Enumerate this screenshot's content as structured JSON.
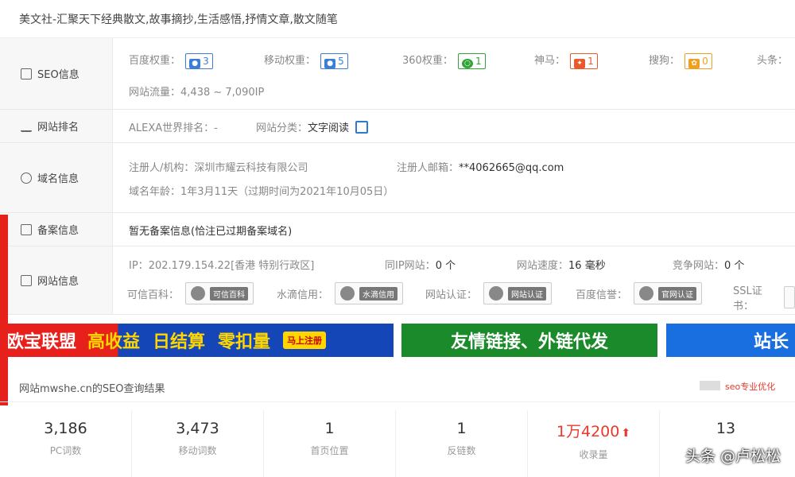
{
  "page_title": "美文社-汇聚天下经典散文,故事摘抄,生活感悟,抒情文章,散文随笔",
  "seo_row": {
    "label": "SEO信息",
    "items": [
      {
        "label": "百度权重：",
        "value": "3",
        "color": "#3a7fd5"
      },
      {
        "label": "移动权重：",
        "value": "5",
        "color": "#3a7fd5"
      },
      {
        "label": "360权重：",
        "value": "1",
        "color": "#2fa535"
      },
      {
        "label": "神马：",
        "value": "1",
        "color": "#e85a2c"
      },
      {
        "label": "搜狗：",
        "value": "0",
        "color": "#f0a020"
      },
      {
        "label": "头条：",
        "value": ""
      }
    ],
    "traffic_label": "网站流量：",
    "traffic_value": "4,438 ~ 7,090IP"
  },
  "rank_row": {
    "label": "网站排名",
    "alexa_label": "ALEXA世界排名：",
    "alexa_value": "-",
    "category_label": "网站分类：",
    "category_value": "文字阅读"
  },
  "domain_row": {
    "label": "域名信息",
    "registrant_label": "注册人/机构：",
    "registrant_value": "深圳市耀云科技有限公司",
    "email_label": "注册人邮箱：",
    "email_value": "**4062665@qq.com",
    "age_label": "域名年龄：",
    "age_value": "1年3月11天（过期时间为2021年10月05日）"
  },
  "icp_row": {
    "label": "备案信息",
    "value": "暂无备案信息(恰注已过期备案域名)"
  },
  "site_row": {
    "label": "网站信息",
    "ip_label": "IP：",
    "ip_value": "202.179.154.22[香港 特别行政区]",
    "sameip_label": "同IP网站：",
    "sameip_value": "0 个",
    "speed_label": "网站速度：",
    "speed_value": "16 毫秒",
    "competitor_label": "竞争网站：",
    "competitor_value": "0 个",
    "trust": [
      {
        "label": "可信百科：",
        "badge": "可信百科"
      },
      {
        "label": "水滴信用：",
        "badge": "水滴信用"
      },
      {
        "label": "网站认证：",
        "badge": "网站认证"
      },
      {
        "label": "百度信誉：",
        "badge": "官网认证"
      },
      {
        "label": "SSL证书：",
        "badge": ""
      }
    ]
  },
  "banners": {
    "b1_text": "欧宝联盟",
    "b1_tags": [
      "高收益",
      "日结算",
      "零扣量"
    ],
    "b1_btn": "马上注册",
    "b2_text": "友情链接、外链代发",
    "b3_text": "站长"
  },
  "seo_result": {
    "title": "网站mwshe.cn的SEO查询结果",
    "right_text": "seo专业优化"
  },
  "stats": [
    {
      "value": "3,186",
      "label": "PC词数"
    },
    {
      "value": "3,473",
      "label": "移动词数"
    },
    {
      "value": "1",
      "label": "首页位置"
    },
    {
      "value": "1",
      "label": "反链数"
    },
    {
      "value": "1万4200",
      "label": "收录量",
      "accent": "#e83a2b",
      "arrow": "⬆"
    },
    {
      "value": "13",
      "label": ""
    }
  ],
  "watermark": "头条 @卢松松",
  "colors": {
    "label_bg": "#f7f7f7",
    "accent_red": "#e83a2b",
    "banner_green": "#1a8a2a",
    "banner_blue": "#1a6fe0"
  }
}
